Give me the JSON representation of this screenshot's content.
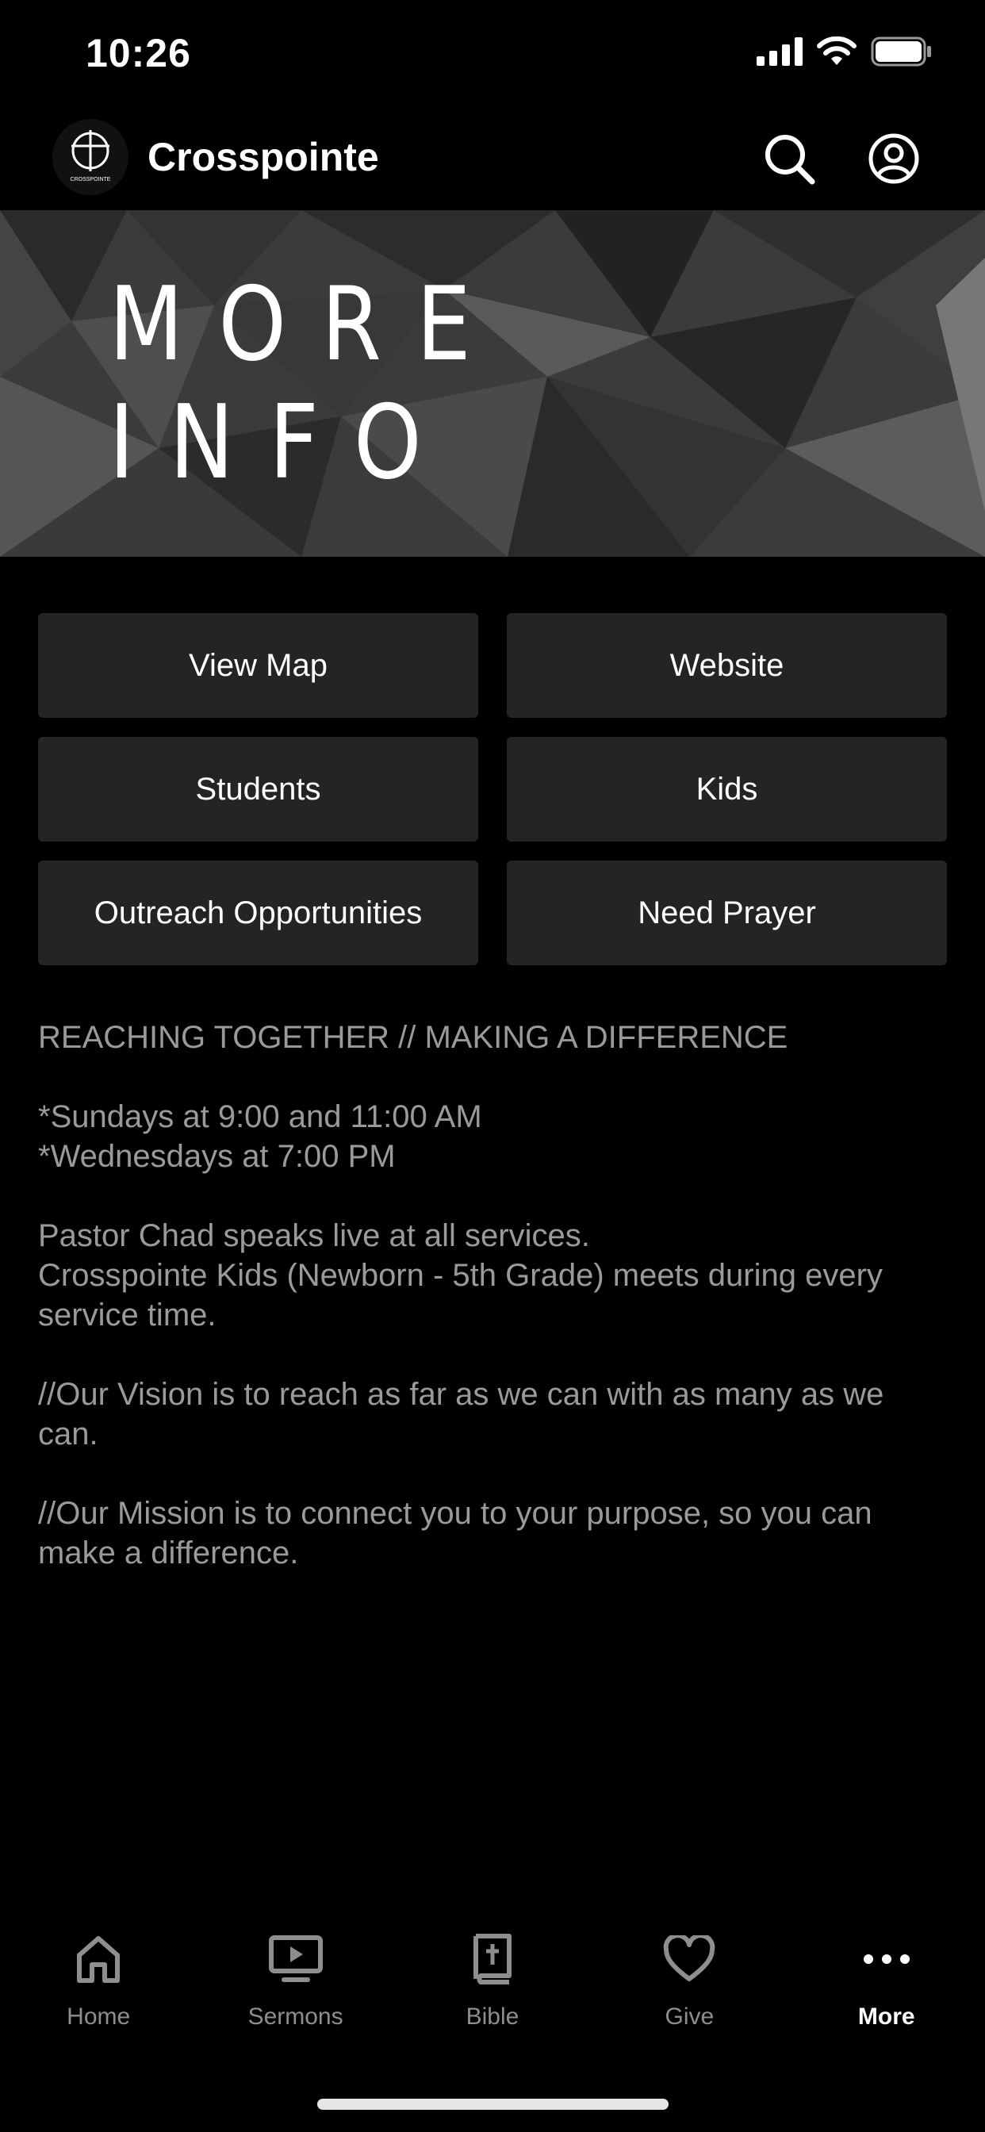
{
  "status": {
    "time": "10:26"
  },
  "header": {
    "app_name": "Crosspointe",
    "logo_text": "CROSSPOINTE",
    "search_icon": "search-icon",
    "profile_icon": "profile-icon"
  },
  "banner": {
    "title": "MORE INFO"
  },
  "buttons": [
    {
      "label": "View Map"
    },
    {
      "label": "Website"
    },
    {
      "label": "Students"
    },
    {
      "label": "Kids"
    },
    {
      "label": "Outreach Opportunities"
    },
    {
      "label": "Need Prayer"
    }
  ],
  "content": {
    "tagline": "REACHING TOGETHER //  MAKING A DIFFERENCE",
    "service_times": [
      "*Sundays at 9:00 and 11:00 AM",
      "*Wednesdays at 7:00 PM"
    ],
    "services_info": [
      "Pastor Chad speaks live at all services.",
      "Crosspointe Kids (Newborn - 5th Grade) meets during every service time."
    ],
    "vision": "//Our Vision is to reach as far as we can with as many as we can.",
    "mission": "//Our Mission is to connect you to your purpose, so you can make a difference."
  },
  "tabs": [
    {
      "label": "Home",
      "icon": "home-icon",
      "active": false
    },
    {
      "label": "Sermons",
      "icon": "sermons-icon",
      "active": false
    },
    {
      "label": "Bible",
      "icon": "bible-icon",
      "active": false
    },
    {
      "label": "Give",
      "icon": "heart-icon",
      "active": false
    },
    {
      "label": "More",
      "icon": "more-icon",
      "active": true
    }
  ],
  "colors": {
    "background": "#000000",
    "button_bg": "#242424",
    "body_text": "#9a9a9a",
    "tab_inactive": "#8e8e8e",
    "tab_active": "#ffffff"
  }
}
